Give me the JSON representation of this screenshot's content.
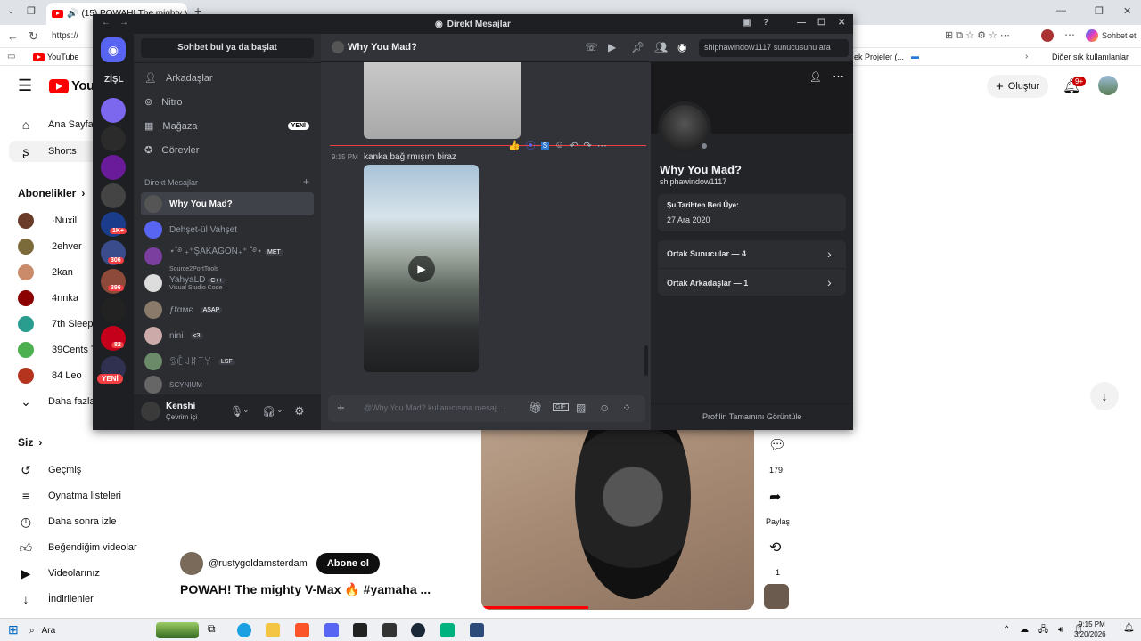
{
  "browser": {
    "tab_title": "(15) POWAH! The mighty V-M",
    "address": "https://",
    "bookmarks": {
      "youtube": "YouTube",
      "right1": "ek Projeler (...",
      "other": "Diğer sık kullanılanlar"
    },
    "chat_label": "Sohbet et"
  },
  "youtube": {
    "logo_text": "YouT",
    "create_label": "Oluştur",
    "notif_count": "9+",
    "nav": {
      "home": "Ana Sayfa",
      "shorts": "Shorts"
    },
    "subs_header": "Abonelikler",
    "subs": [
      {
        "name": "·Nuxil"
      },
      {
        "name": "2ehver"
      },
      {
        "name": "2kan"
      },
      {
        "name": "4nnka"
      },
      {
        "name": "7th Sleepe"
      },
      {
        "name": "39Cents T"
      },
      {
        "name": "84 Leo"
      }
    ],
    "more": "Daha fazla",
    "you_header": "Siz",
    "you_items": [
      "Geçmiş",
      "Oynatma listeleri",
      "Daha sonra izle",
      "Beğendiğim videolar",
      "Videolarınız",
      "İndirilenler"
    ],
    "channel": "@rustygoldamsterdam",
    "subscribe": "Abone ol",
    "video_title": "POWAH! The mighty V-Max 🔥 #yamaha ...",
    "comments_count": "179",
    "share_label": "Paylaş",
    "remix_count": "1"
  },
  "discord": {
    "window_title": "Direkt Mesajlar",
    "search_placeholder": "Sohbet bul ya da başlat",
    "guild_label": "ZİŞL",
    "guild_badges": [
      "1K+",
      "306",
      "396",
      "82"
    ],
    "new_badge": "YENİ",
    "nav": {
      "friends": "Arkadaşlar",
      "nitro": "Nitro",
      "shop": "Mağaza",
      "shop_badge": "YENİ",
      "quests": "Görevler"
    },
    "dm_header": "Direkt Mesajlar",
    "dms": [
      {
        "name": "Why You Mad?",
        "sub": ""
      },
      {
        "name": "Dehşet-ül Vahşet",
        "sub": ""
      },
      {
        "name": "⋆˚࿔ ₊⁺ŞAKAGON₊⁺ ˚࿔⋆",
        "sub": "Source2PortTools",
        "tag": "MET"
      },
      {
        "name": "YahyaLD",
        "sub": "Visual Studio Code",
        "tag": "C++"
      },
      {
        "name": "ƒℓαмє",
        "sub": "",
        "tag": "ASAP"
      },
      {
        "name": "nini",
        "sub": "",
        "tag": "<3"
      },
      {
        "name": "ꌚꍟꈤꍏ꓄ꌩ",
        "sub": "",
        "tag": "LSF"
      },
      {
        "name": "SCYNIUM",
        "sub": ""
      }
    ],
    "user": {
      "name": "Kenshi",
      "status": "Çevrim içi"
    },
    "channel_name": "Why You Mad?",
    "header_search": "shiphawindow1117 sunucusunu ara",
    "message": {
      "time": "9:15 PM",
      "text": "kanka bağırmışım biraz"
    },
    "composer_placeholder": "@Why You Mad? kullanıcısına mesaj ...",
    "profile": {
      "display_name": "Why You Mad?",
      "username": "shiphawindow1117",
      "member_since_label": "Şu Tarihten Beri Üye:",
      "member_since": "27 Ara 2020",
      "mutual_servers": "Ortak Sunucular — 4",
      "mutual_friends": "Ortak Arkadaşlar — 1",
      "view_full": "Profilin Tamamını Görüntüle"
    }
  },
  "taskbar": {
    "search": "Ara",
    "time": "9:15 PM",
    "date": "3/20/2026"
  }
}
